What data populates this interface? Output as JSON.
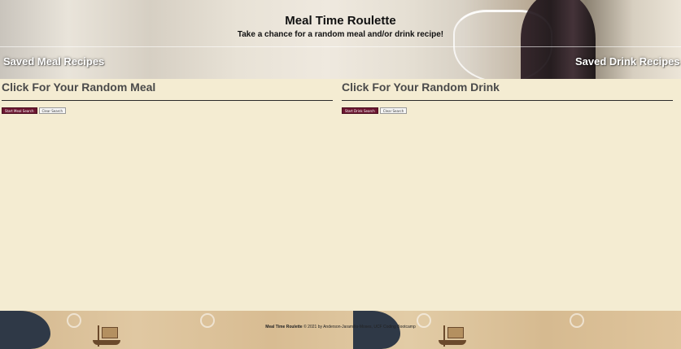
{
  "header": {
    "title": "Meal Time Roulette",
    "tagline": "Take a chance for a random meal and/or drink recipe!",
    "saved_meals_label": "Saved Meal Recipes",
    "saved_drinks_label": "Saved Drink Recipes"
  },
  "meal": {
    "heading": "Click For Your Random Meal",
    "start_label": "Start Meal Search",
    "clear_label": "Clear Search"
  },
  "drink": {
    "heading": "Click For Your Random Drink",
    "start_label": "Start Drink Search",
    "clear_label": "Clear Search"
  },
  "footer": {
    "brand": "Meal Time Roulette",
    "credits": "© 2021 by Anderson-Jaramillo-Moses, UCF Coding Bootcamp"
  },
  "colors": {
    "page_bg": "#f4ecd2",
    "start_button": "#6b1530",
    "heading_text": "#4a4a4a"
  }
}
